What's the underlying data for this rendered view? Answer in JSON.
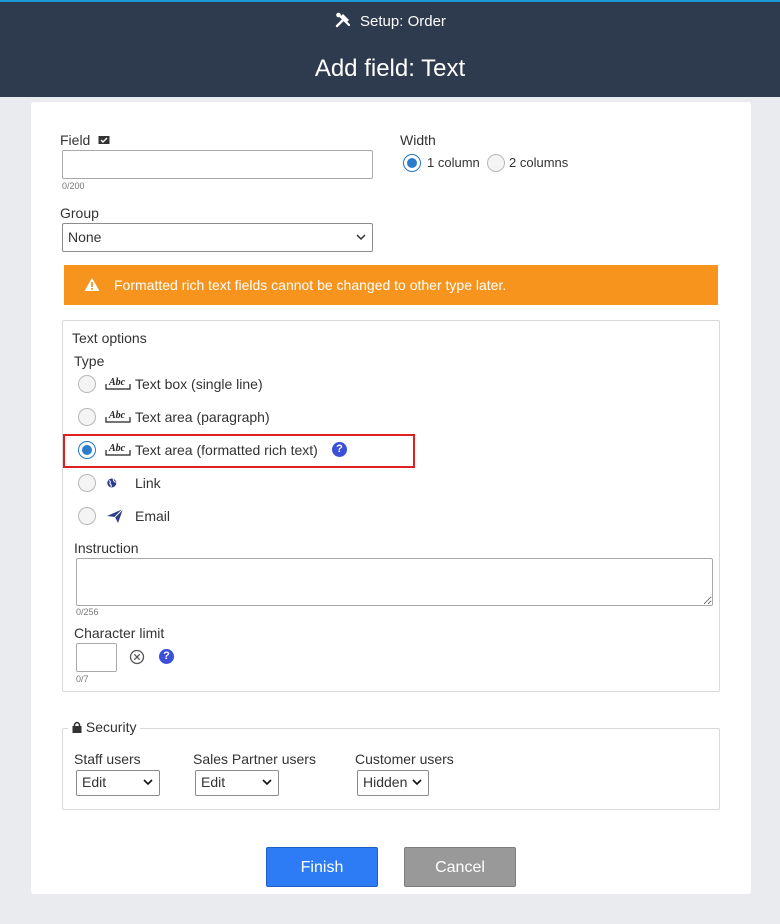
{
  "header": {
    "breadcrumb": "Setup: Order",
    "title": "Add field: Text"
  },
  "field": {
    "label": "Field",
    "value": "",
    "counter": "0/200"
  },
  "width": {
    "label": "Width",
    "options": [
      "1 column",
      "2 columns"
    ],
    "selected": "1 column"
  },
  "group": {
    "label": "Group",
    "selected": "None"
  },
  "warning": {
    "text": "Formatted rich text fields cannot be changed to other type later."
  },
  "text_options": {
    "legend": "Text options",
    "type_label": "Type",
    "types": [
      {
        "label": "Text box (single line)",
        "icon": "abc-icon",
        "selected": false
      },
      {
        "label": "Text area (paragraph)",
        "icon": "abc-icon",
        "selected": false
      },
      {
        "label": "Text area (formatted rich text)",
        "icon": "abc-icon",
        "selected": true
      },
      {
        "label": "Link",
        "icon": "globe-icon",
        "selected": false
      },
      {
        "label": "Email",
        "icon": "paper-plane-icon",
        "selected": false
      }
    ],
    "instruction_label": "Instruction",
    "instruction_value": "",
    "instruction_counter": "0/256",
    "char_limit_label": "Character limit",
    "char_limit_value": "",
    "char_limit_counter": "0/7"
  },
  "security": {
    "legend": "Security",
    "staff": {
      "label": "Staff users",
      "value": "Edit"
    },
    "partner": {
      "label": "Sales Partner users",
      "value": "Edit"
    },
    "customer": {
      "label": "Customer users",
      "value": "Hidden"
    }
  },
  "buttons": {
    "finish": "Finish",
    "cancel": "Cancel"
  },
  "colors": {
    "header_bg": "#2e3b4e",
    "warning_bg": "#f7941d",
    "finish_bg": "#2d7cf6",
    "cancel_bg": "#999999",
    "highlight_border": "#e02020"
  }
}
